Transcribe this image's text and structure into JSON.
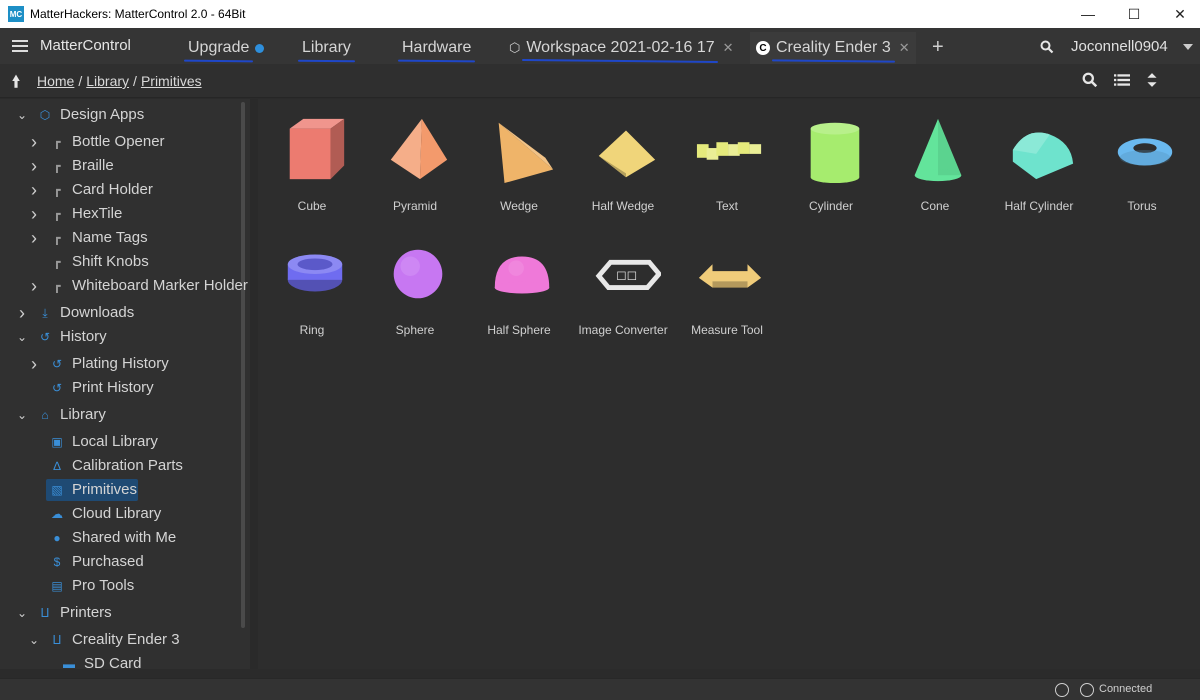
{
  "window": {
    "logo": "MC",
    "title": "MatterHackers: MatterControl 2.0 - 64Bit",
    "minimize_icon": "minimize-icon",
    "maximize_icon": "maximize-icon",
    "close_icon": "close-icon"
  },
  "topbar": {
    "app_name": "MatterControl",
    "tabs": [
      {
        "label": "Upgrade",
        "has_dot": true,
        "dot_color": "#2e8fdc"
      },
      {
        "label": "Library"
      },
      {
        "label": "Hardware"
      },
      {
        "label": "Workspace 2021-02-16 17",
        "icon": "cube-icon",
        "closable": true
      },
      {
        "label": "Creality Ender 3",
        "icon": "creality-icon",
        "icon_text": "C",
        "closable": true
      }
    ],
    "add_tab_label": "+",
    "username": "Joconnell0904"
  },
  "breadcrumb": {
    "items": [
      "Home",
      "Library",
      "Primitives"
    ],
    "separator": "/"
  },
  "sidebar": {
    "items": [
      {
        "label": "Design Apps",
        "icon": "design-apps-icon",
        "expanded": true
      },
      {
        "label": "Bottle Opener",
        "icon": "folder-icon"
      },
      {
        "label": "Braille",
        "icon": "folder-icon"
      },
      {
        "label": "Card Holder",
        "icon": "folder-icon"
      },
      {
        "label": "HexTile",
        "icon": "folder-icon"
      },
      {
        "label": "Name Tags",
        "icon": "folder-icon"
      },
      {
        "label": "Shift Knobs",
        "icon": "folder-icon"
      },
      {
        "label": "Whiteboard Marker Holder",
        "icon": "folder-icon"
      },
      {
        "label": "Downloads",
        "icon": "download-icon"
      },
      {
        "label": "History",
        "icon": "history-icon",
        "expanded": true
      },
      {
        "label": "Plating History",
        "icon": "history-icon"
      },
      {
        "label": "Print History",
        "icon": "history-icon"
      },
      {
        "label": "Library",
        "icon": "library-icon",
        "expanded": true
      },
      {
        "label": "Local Library",
        "icon": "local-library-icon"
      },
      {
        "label": "Calibration Parts",
        "icon": "calibration-icon"
      },
      {
        "label": "Primitives",
        "icon": "primitives-icon",
        "selected": true
      },
      {
        "label": "Cloud Library",
        "icon": "cloud-icon"
      },
      {
        "label": "Shared with Me",
        "icon": "user-icon"
      },
      {
        "label": "Purchased",
        "icon": "dollar-icon",
        "glyph": "$"
      },
      {
        "label": "Pro Tools",
        "icon": "pro-tools-icon"
      },
      {
        "label": "Printers",
        "icon": "printer-icon",
        "expanded": true
      },
      {
        "label": "Creality Ender 3",
        "icon": "printer-icon",
        "expanded": true
      },
      {
        "label": "SD Card",
        "icon": "sd-card-icon"
      }
    ]
  },
  "primitives": [
    {
      "label": "Cube",
      "color": "#ec7b70"
    },
    {
      "label": "Pyramid",
      "color": "#f39a6c"
    },
    {
      "label": "Wedge",
      "color": "#efb469"
    },
    {
      "label": "Half Wedge",
      "color": "#f0d57a"
    },
    {
      "label": "Text",
      "color": "#e5ea7c"
    },
    {
      "label": "Cylinder",
      "color": "#a6ec6e"
    },
    {
      "label": "Cone",
      "color": "#63e49b"
    },
    {
      "label": "Half Cylinder",
      "color": "#6ee3cd"
    },
    {
      "label": "Torus",
      "color": "#6ab9ef"
    },
    {
      "label": "Ring",
      "color": "#6f6cf0"
    },
    {
      "label": "Sphere",
      "color": "#c777f2"
    },
    {
      "label": "Half Sphere",
      "color": "#ef79d9"
    },
    {
      "label": "Image Converter",
      "color": "#e8e8e8"
    },
    {
      "label": "Measure Tool",
      "color": "#f0cc7a"
    }
  ],
  "statusbar": {
    "connection_status": "Connected"
  },
  "colors": {
    "accent": "#3a8fd8",
    "selection": "#1f4a73",
    "tab_underline": "#1f47c8"
  }
}
